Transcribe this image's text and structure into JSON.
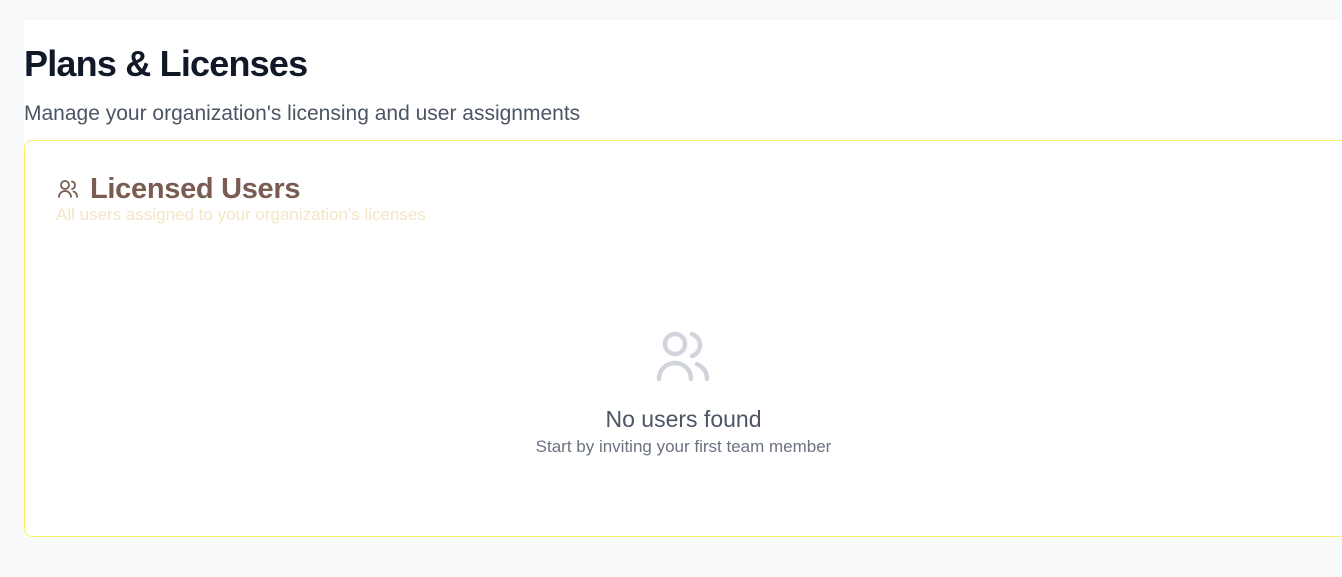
{
  "header": {
    "title": "Plans & Licenses",
    "subtitle": "Manage your organization's licensing and user assignments"
  },
  "licensed_users": {
    "title": "Licensed Users",
    "subtitle": "All users assigned to your organization's licenses",
    "icon": "users-icon",
    "empty_state": {
      "icon": "users-icon",
      "title": "No users found",
      "message": "Start by inviting your first team member"
    }
  },
  "colors": {
    "page_background": "#f8f9fb",
    "card_border": "#f5f16b",
    "title": "#111827",
    "subtitle": "#4b5563",
    "card_title": "#7a5c52",
    "card_subtitle": "#f3e6c7",
    "empty_icon": "#d1d5db",
    "empty_text": "#6b7280"
  }
}
